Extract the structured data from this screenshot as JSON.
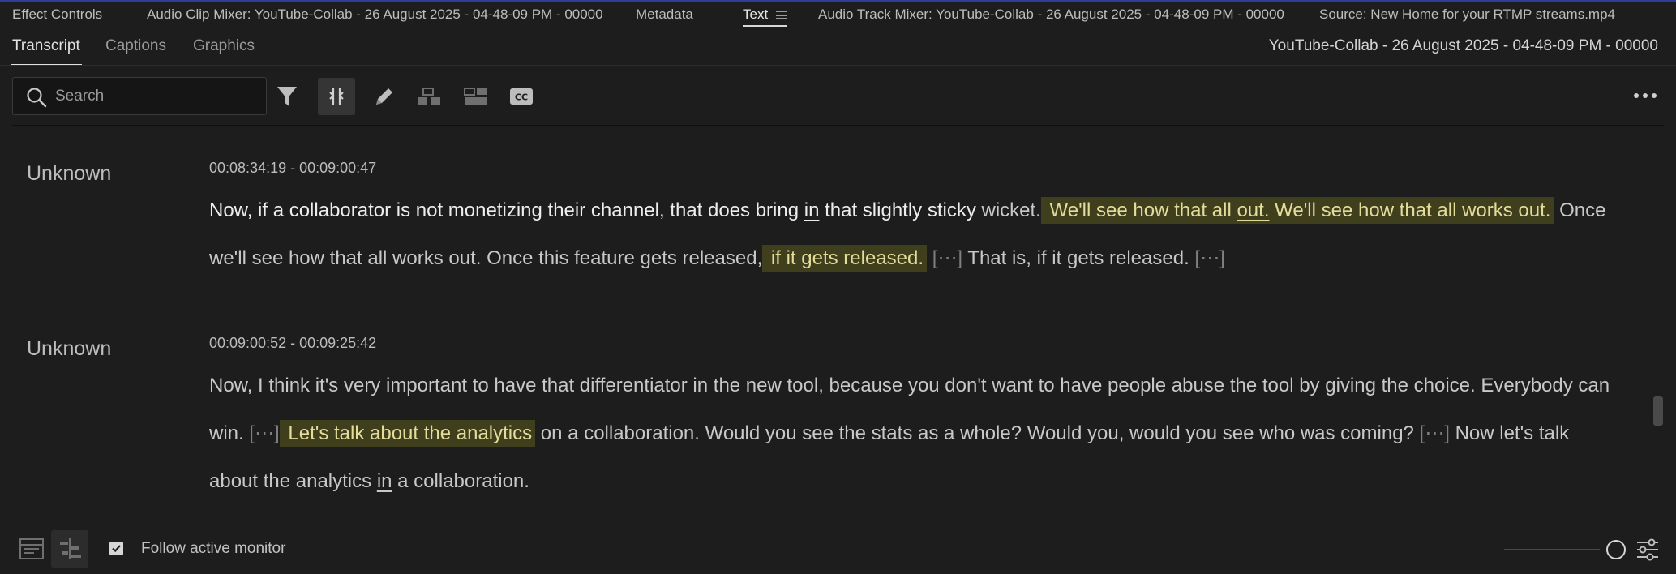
{
  "panel_tabs": {
    "effect_controls": "Effect Controls",
    "audio_clip_mixer": "Audio Clip Mixer: YouTube-Collab - 26 August 2025 - 04-48-09 PM - 00000",
    "metadata": "Metadata",
    "text": "Text",
    "audio_track_mixer": "Audio Track Mixer: YouTube-Collab - 26 August 2025 - 04-48-09 PM - 00000",
    "source": "Source: New Home for your RTMP streams.mp4"
  },
  "sub_tabs": {
    "transcript": "Transcript",
    "captions": "Captions",
    "graphics": "Graphics"
  },
  "sequence_name": "YouTube-Collab - 26 August 2025 - 04-48-09 PM - 00000",
  "toolbar": {
    "search_placeholder": "Search"
  },
  "transcript": [
    {
      "speaker": "Unknown",
      "timecode": "00:08:34:19 - 00:09:00:47",
      "segments": {
        "s1": "Now, if a collaborator is not monetizing their channel, that does bring ",
        "s2": "in",
        "s3": " that slightly sticky ",
        "s4": "wicket.",
        "h1a": " We'll see how that all ",
        "h1b": "out.",
        "h1c": " We'll see how that all works out.",
        "s5": " Once we'll see how that all works out. Once this feature gets released,",
        "h2": " if it gets released.",
        "g1": " [⋯]",
        "s6": " That is, if it gets released.",
        "g2": " [⋯]"
      }
    },
    {
      "speaker": "Unknown",
      "timecode": "00:09:00:52 - 00:09:25:42",
      "segments": {
        "s1": "Now, I think it's very important to have that differentiator in the new tool, because you don't want to have people abuse the tool by giving the choice. Everybody can win.",
        "g1": " [⋯]",
        "h1": " Let's talk about the analytics",
        "s2": " on a collaboration. Would you see the stats as a whole? Would you, would you see who was coming?",
        "g2": " [⋯]",
        "s3": " Now let's talk about the analytics ",
        "s4": "in",
        "s5": " a collaboration."
      }
    }
  ],
  "footer": {
    "follow_label": "Follow active monitor",
    "follow_checked": true
  },
  "colors": {
    "background": "#1d1d1d",
    "highlight_bg": "#3f3f1e",
    "highlight_text": "#e3dc9a"
  }
}
